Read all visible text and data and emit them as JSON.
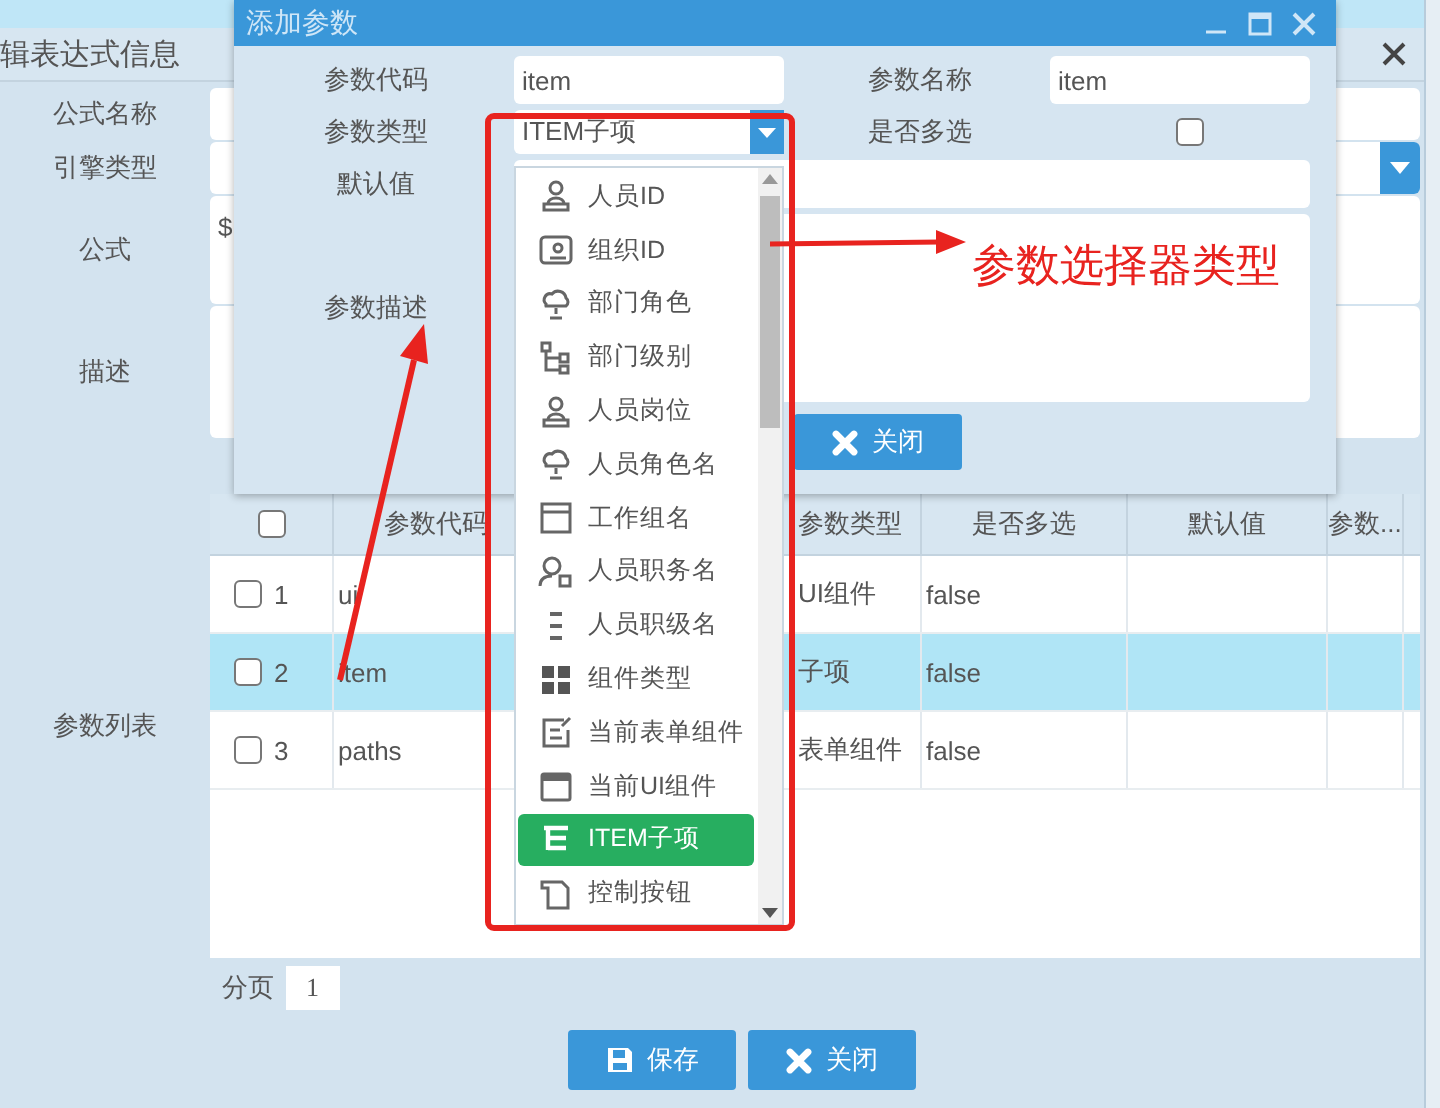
{
  "background_window": {
    "title": "辑表达式信息",
    "fields": [
      {
        "label": "公式名称",
        "kind": "text"
      },
      {
        "label": "引擎类型",
        "kind": "select"
      },
      {
        "label": "公式",
        "kind": "textarea",
        "value": "$"
      },
      {
        "label": "描述",
        "kind": "textarea"
      }
    ],
    "table": {
      "label": "参数列表",
      "select_all": {
        "checked": false
      },
      "columns": [
        "参数代码",
        "参数类型",
        "是否多选",
        "默认值",
        "参数..."
      ],
      "rows": [
        {
          "checked": false,
          "number": "1",
          "code": "ui",
          "type": "UI组件",
          "multiple": "false",
          "selected": false
        },
        {
          "checked": false,
          "number": "2",
          "code": "item",
          "type": "子项",
          "multiple": "false",
          "selected": true
        },
        {
          "checked": false,
          "number": "3",
          "code": "paths",
          "type": "表单组件",
          "multiple": "false",
          "selected": false
        }
      ]
    },
    "pagination": {
      "label": "分页",
      "page": "1"
    },
    "buttons": [
      {
        "label": "保存",
        "kind": "save"
      },
      {
        "label": "关闭",
        "kind": "close"
      }
    ]
  },
  "dialog": {
    "title": "添加参数",
    "code": {
      "label": "参数代码",
      "value": "item"
    },
    "name": {
      "label": "参数名称",
      "value": "item"
    },
    "type": {
      "label": "参数类型",
      "value": "ITEM子项"
    },
    "multiple": {
      "label": "是否多选",
      "checked": false
    },
    "default": {
      "label": "默认值"
    },
    "description": {
      "label": "参数描述"
    },
    "buttons": [
      {
        "label": "关闭",
        "kind": "close"
      }
    ],
    "dropdown": {
      "options": [
        {
          "label": "人员ID",
          "selected": false
        },
        {
          "label": "组织ID",
          "selected": false
        },
        {
          "label": "部门角色",
          "selected": false
        },
        {
          "label": "部门级别",
          "selected": false
        },
        {
          "label": "人员岗位",
          "selected": false
        },
        {
          "label": "人员角色名",
          "selected": false
        },
        {
          "label": "工作组名",
          "selected": false
        },
        {
          "label": "人员职务名",
          "selected": false
        },
        {
          "label": "人员职级名",
          "selected": false
        },
        {
          "label": "组件类型",
          "selected": false
        },
        {
          "label": "当前表单组件",
          "selected": false
        },
        {
          "label": "当前UI组件",
          "selected": false
        },
        {
          "label": "ITEM子项",
          "selected": true
        },
        {
          "label": "控制按钮",
          "selected": false
        }
      ]
    }
  },
  "annotation": {
    "callout": "参数选择器类型"
  }
}
